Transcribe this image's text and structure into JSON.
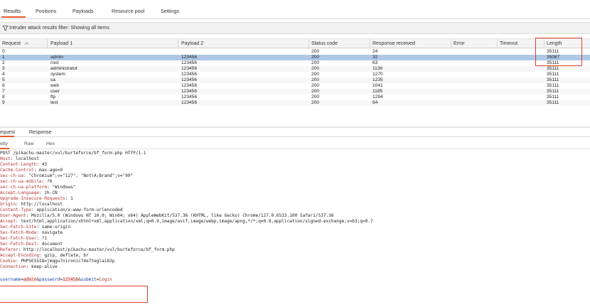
{
  "top_tabs": [
    "Results",
    "Positions",
    "Payloads",
    "Resource pool",
    "Settings"
  ],
  "filter": {
    "text": "Intruder attack results filter: Showing all items"
  },
  "table": {
    "columns": [
      "Request",
      "Payload 1",
      "Payload 2",
      "Status code",
      "Response received",
      "Error",
      "Timeout",
      "Length"
    ],
    "rows": [
      [
        "0",
        "",
        "",
        "200",
        "24",
        "",
        "",
        "35111"
      ],
      [
        "1",
        "admin",
        "123456",
        "200",
        "32",
        "",
        "",
        "35087"
      ],
      [
        "2",
        "root",
        "123456",
        "200",
        "63",
        "",
        "",
        "35111"
      ],
      [
        "3",
        "administrator",
        "123456",
        "200",
        "1136",
        "",
        "",
        "35111"
      ],
      [
        "4",
        "system",
        "123456",
        "200",
        "1270",
        "",
        "",
        "35111"
      ],
      [
        "5",
        "sa",
        "123456",
        "200",
        "1235",
        "",
        "",
        "35111"
      ],
      [
        "6",
        "web",
        "123456",
        "200",
        "1041",
        "",
        "",
        "35111"
      ],
      [
        "7",
        "user",
        "123456",
        "200",
        "1185",
        "",
        "",
        "35111"
      ],
      [
        "8",
        "ftp",
        "123456",
        "200",
        "1294",
        "",
        "",
        "35111"
      ],
      [
        "9",
        "test",
        "123456",
        "200",
        "64",
        "",
        "",
        "35111"
      ]
    ],
    "selected_row": 1
  },
  "req_resp_tabs": [
    "equest",
    "Response"
  ],
  "view_tabs": [
    "etty",
    "Raw",
    "Hex"
  ],
  "request": {
    "request_line": "POST /pikachu-master/vul/burteforce/bf_form.php HTTP/1.1",
    "headers": [
      [
        "Host",
        "localhost"
      ],
      [
        "Content-Length",
        "43"
      ],
      [
        "Cache-Control",
        "max-age=0"
      ],
      [
        "sec-ch-ua",
        "\"Chromium\";v=\"127\", \"Not)A;Brand\";v=\"99\""
      ],
      [
        "sec-ch-ua-mobile",
        "?0"
      ],
      [
        "sec-ch-ua-platform",
        "\"Windows\""
      ],
      [
        "Accept-Language",
        "zh-CN"
      ],
      [
        "Upgrade-Insecure-Requests",
        "1"
      ],
      [
        "Origin",
        "http://localhost"
      ],
      [
        "Content-Type",
        "application/x-www-form-urlencoded"
      ],
      [
        "User-Agent",
        "Mozilla/5.0 (Windows NT 10.0; Win64; x64) AppleWebKit/537.36 (KHTML, like Gecko) Chrome/127.0.6533.100 Safari/537.36"
      ],
      [
        "Accept",
        "text/html,application/xhtml+xml,application/xml;q=0.9,image/avif,image/webp,image/apng,*/*;q=0.8,application/signed-exchange;v=b3;q=0.7"
      ],
      [
        "Sec-Fetch-Site",
        "same-origin"
      ],
      [
        "Sec-Fetch-Mode",
        "navigate"
      ],
      [
        "Sec-Fetch-User",
        "?1"
      ],
      [
        "Sec-Fetch-Dest",
        "document"
      ],
      [
        "Referer",
        "http://localhost/pikachu-master/vul/burteforce/bf_form.php"
      ],
      [
        "Accept-Encoding",
        "gzip, deflate, br"
      ],
      [
        "Cookie",
        "PHPSESSID=jmqgu7nironic74e7teglai83p"
      ],
      [
        "Connection",
        "keep-alive"
      ]
    ],
    "body": {
      "k1": "username",
      "eq1": "=",
      "v1": "admin",
      "amp1": "&",
      "k2": "password",
      "eq2": "=",
      "v2": "123456",
      "amp2": "&",
      "k3": "submit",
      "eq3": "=",
      "v3": "Login"
    }
  },
  "colors": {
    "accent": "#e8592a",
    "selection": "#afc8e6",
    "highlight_box": "#e23b2b"
  }
}
